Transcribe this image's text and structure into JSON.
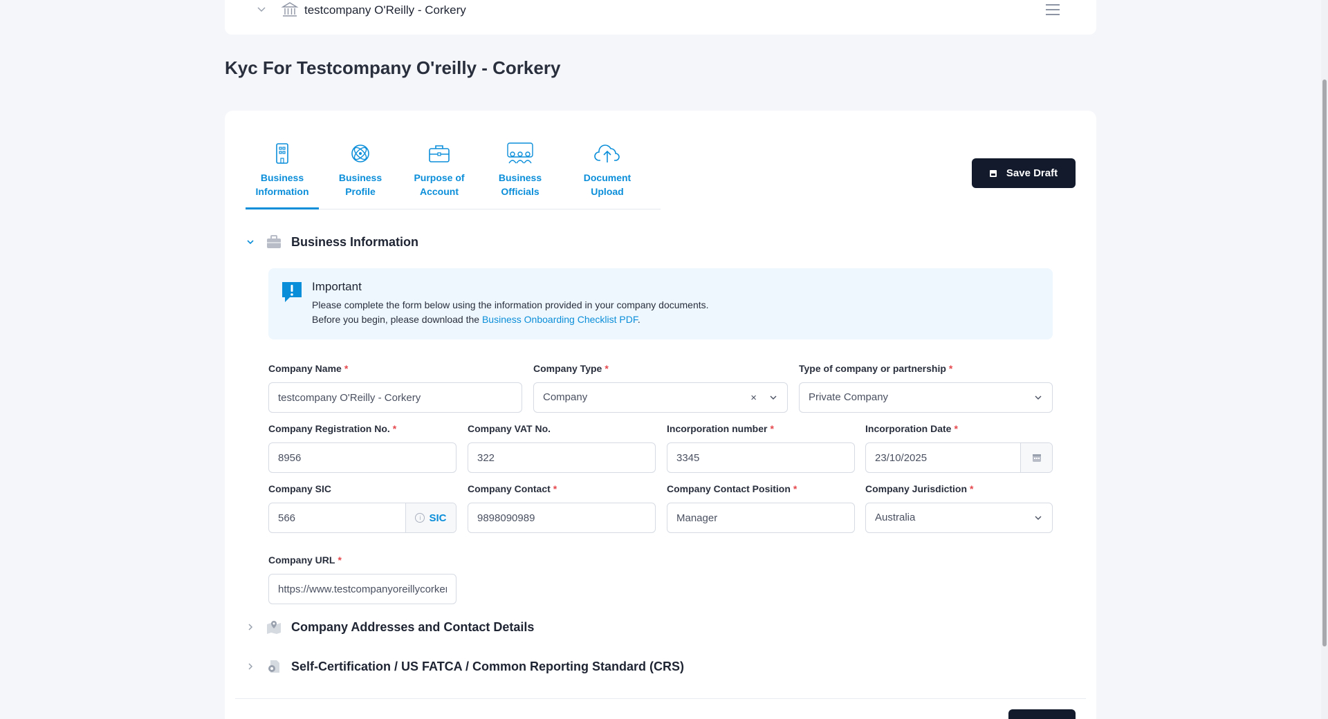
{
  "header": {
    "company_name": "testcompany O'Reilly - Corkery",
    "bank_icon": "bank-icon",
    "menu_icon": "hamburger-menu-icon"
  },
  "page": {
    "title": "Kyc For Testcompany O'reilly - Corkery"
  },
  "tabs": [
    {
      "line1": "Business",
      "line2": "Information",
      "icon": "building-icon",
      "active": true
    },
    {
      "line1": "Business",
      "line2": "Profile",
      "icon": "atom-icon",
      "active": false
    },
    {
      "line1": "Purpose of",
      "line2": "Account",
      "icon": "briefcase-icon",
      "active": false
    },
    {
      "line1": "Business",
      "line2": "Officials",
      "icon": "people-icon",
      "active": false
    },
    {
      "line1": "Document",
      "line2": "Upload",
      "icon": "cloud-upload-icon",
      "active": false
    }
  ],
  "toolbar": {
    "save_draft": "Save Draft"
  },
  "sections": {
    "business_info": {
      "title": "Business Information",
      "expanded": true
    },
    "addresses": {
      "title": "Company Addresses and Contact Details",
      "expanded": false
    },
    "fatca": {
      "title": "Self-Certification / US FATCA / Common Reporting Standard (CRS)",
      "expanded": false
    }
  },
  "notice": {
    "title": "Important",
    "line1": "Please complete the form below using the information provided in your company documents.",
    "line2_prefix": "Before you begin, please download the ",
    "link": "Business Onboarding Checklist PDF",
    "line2_suffix": "."
  },
  "form": {
    "company_name": {
      "label": "Company Name",
      "required": "*",
      "value": "testcompany O'Reilly - Corkery"
    },
    "company_type": {
      "label": "Company Type",
      "required": "*",
      "value": "Company",
      "clear": "×"
    },
    "partnership_type": {
      "label": "Type of company or partnership",
      "required": "*",
      "value": "Private Company"
    },
    "registration_no": {
      "label": "Company Registration No.",
      "required": "*",
      "value": "8956"
    },
    "vat_no": {
      "label": "Company VAT No.",
      "value": "322"
    },
    "incorporation_number": {
      "label": "Incorporation number",
      "required": "*",
      "value": "3345"
    },
    "incorporation_date": {
      "label": "Incorporation Date",
      "required": "*",
      "value": "23/10/2025"
    },
    "sic": {
      "label": "Company SIC",
      "value": "566",
      "addon": "SIC"
    },
    "contact": {
      "label": "Company Contact",
      "required": "*",
      "value": "9898090989"
    },
    "contact_position": {
      "label": "Company Contact Position",
      "required": "*",
      "value": "Manager"
    },
    "jurisdiction": {
      "label": "Company Jurisdiction",
      "required": "*",
      "value": "Australia"
    },
    "url": {
      "label": "Company URL",
      "required": "*",
      "value": "https://www.testcompanyoreillycorkery.com"
    }
  },
  "colors": {
    "accent": "#0b8ed9",
    "primary_button": "#121a2c",
    "required": "#e5484d",
    "notice_bg": "#eef7fd"
  }
}
